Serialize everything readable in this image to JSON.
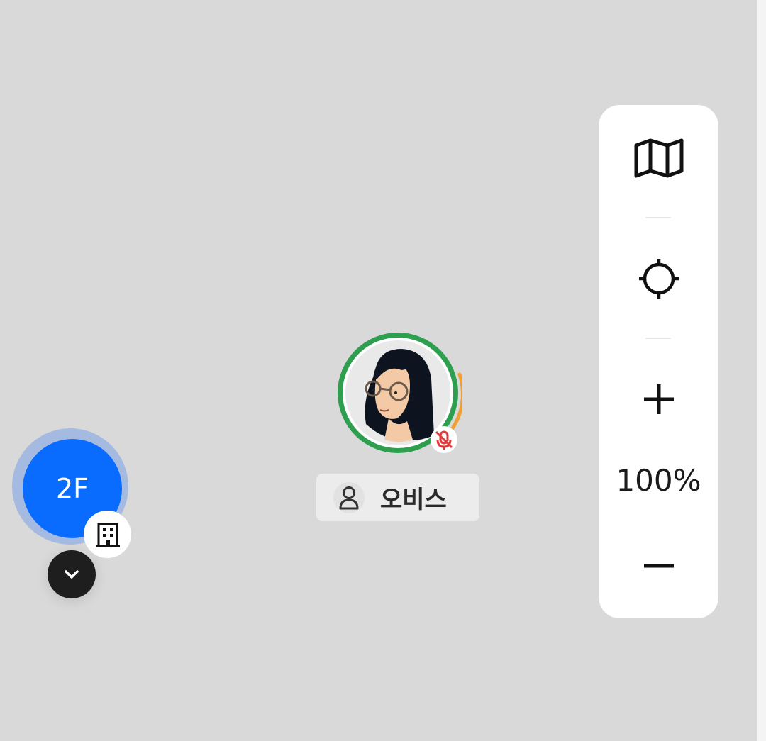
{
  "map_controls": {
    "map_icon": "map-icon",
    "locate_icon": "crosshair-icon",
    "zoom_in_icon": "plus-icon",
    "zoom_level": "100%",
    "zoom_out_icon": "minus-icon"
  },
  "user_marker": {
    "name": "오비스",
    "ring_color": "#2e9e4f",
    "progress_color": "#f0a030",
    "mic_status_icon": "mic-off-icon",
    "person_icon": "person-icon"
  },
  "floor_selector": {
    "current_floor": "2F",
    "building_icon": "building-icon",
    "expand_icon": "chevron-down-icon",
    "accent_color": "#0a6cff"
  }
}
